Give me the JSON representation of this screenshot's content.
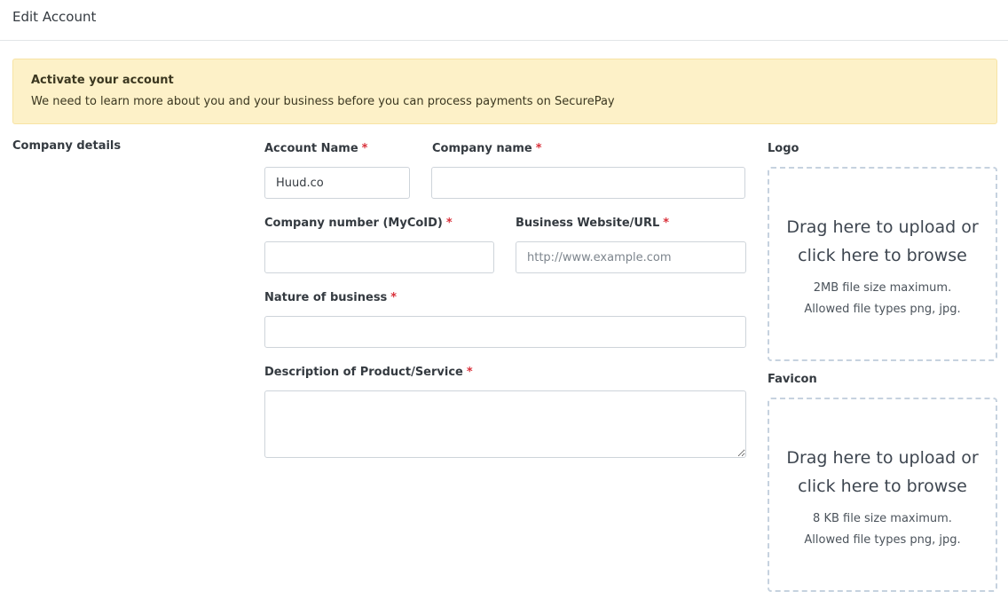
{
  "header": {
    "title": "Edit Account"
  },
  "alert": {
    "title": "Activate your account",
    "message": "We need to learn more about you and your business before you can process payments on SecurePay"
  },
  "section": {
    "label": "Company details"
  },
  "form": {
    "required_mark": "*",
    "account_name": {
      "label": "Account Name",
      "value": "Huud.co",
      "placeholder": ""
    },
    "company_name": {
      "label": "Company name",
      "value": "",
      "placeholder": ""
    },
    "company_number": {
      "label": "Company number (MyCoID)",
      "value": "",
      "placeholder": ""
    },
    "website": {
      "label": "Business Website/URL",
      "value": "",
      "placeholder": "http://www.example.com"
    },
    "nature": {
      "label": "Nature of business",
      "value": "",
      "placeholder": ""
    },
    "description": {
      "label": "Description of Product/Service",
      "value": "",
      "placeholder": ""
    }
  },
  "logo": {
    "label": "Logo",
    "prompt": "Drag here to upload or click here to browse",
    "hint": "2MB file size maximum. Allowed file types png, jpg."
  },
  "favicon": {
    "label": "Favicon",
    "prompt": "Drag here to upload or click here to browse",
    "hint": "8 KB file size maximum. Allowed file types png, jpg."
  }
}
